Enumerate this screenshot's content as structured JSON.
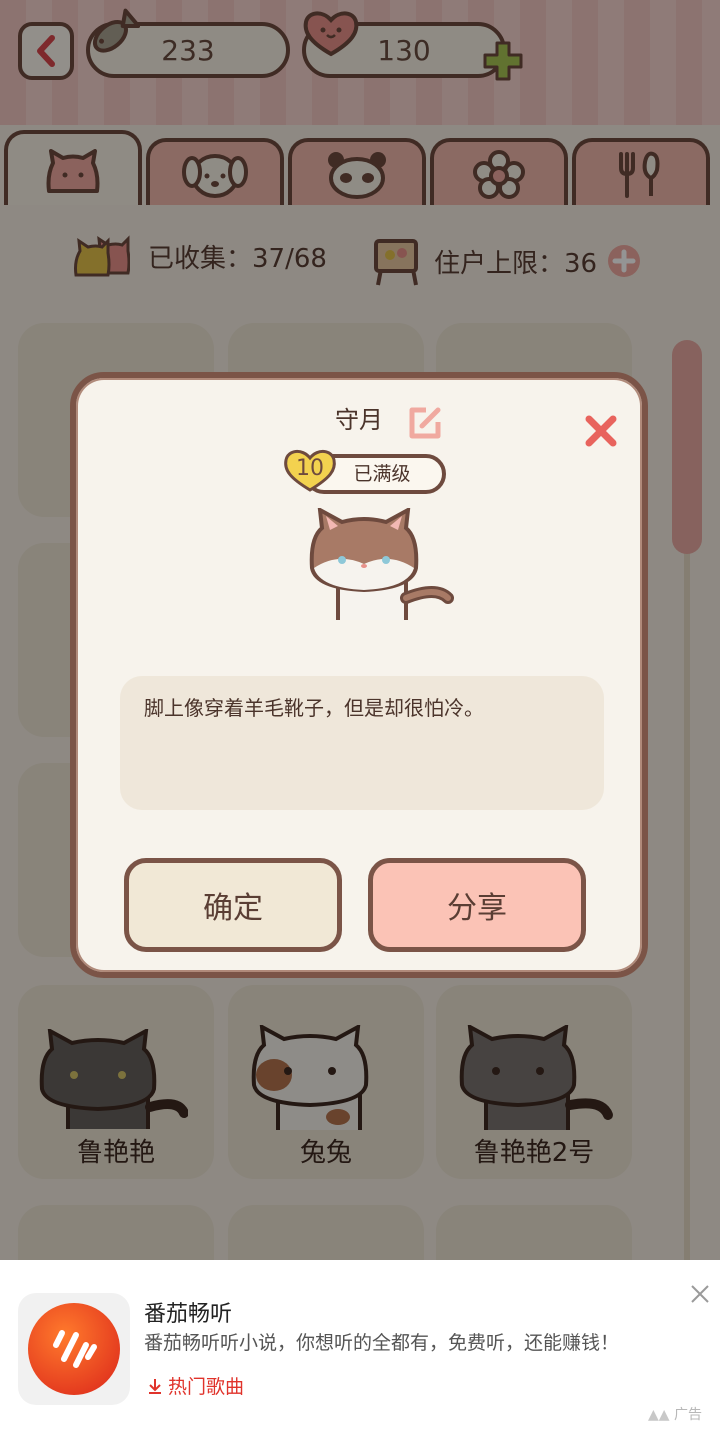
{
  "header": {
    "fish_count": "233",
    "heart_count": "130"
  },
  "tabs": [
    {
      "icon": "cat-face-icon",
      "active": true
    },
    {
      "icon": "dog-face-icon",
      "active": false
    },
    {
      "icon": "panda-face-icon",
      "active": false
    },
    {
      "icon": "flower-icon",
      "active": false
    },
    {
      "icon": "cutlery-icon",
      "active": false
    }
  ],
  "stats": {
    "collected": "已收集：37/68",
    "capacity": "住户上限：36"
  },
  "grid": {
    "cat_names": [
      "鲁艳艳",
      "兔兔",
      "鲁艳艳2号"
    ]
  },
  "dialog": {
    "title": "守月",
    "level": "10",
    "level_status": "已满级",
    "description": "脚上像穿着羊毛靴子，但是却很怕冷。",
    "confirm_label": "确定",
    "share_label": "分享"
  },
  "ad": {
    "title": "番茄畅听",
    "description": "番茄畅听听小说，你想听的全都有，免费听，还能赚钱！",
    "link_label": "热门歌曲",
    "tag": "广告"
  },
  "colors": {
    "accent": "#f0b7ab",
    "outline": "#6e4a3e",
    "panel": "#f7f3ec",
    "share": "#fbc3b6",
    "ad_red": "#e0332b"
  }
}
